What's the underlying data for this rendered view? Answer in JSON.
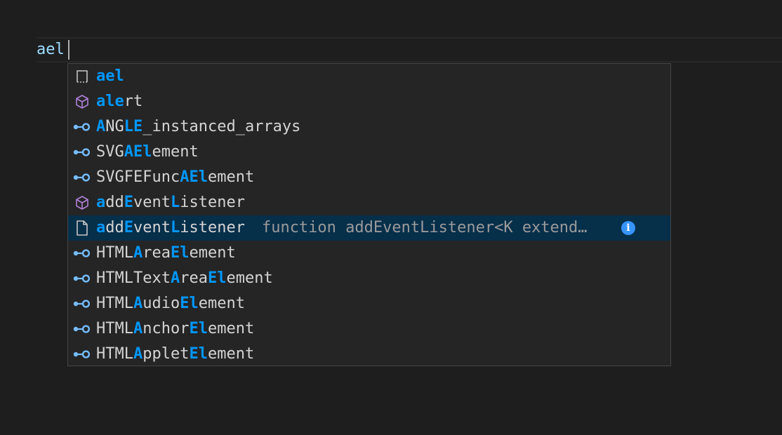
{
  "editor": {
    "typed_text": "ael"
  },
  "colors": {
    "background": "#1e1e1e",
    "widget_background": "#252526",
    "focused_background": "#062f4a",
    "highlight": "#0097fb",
    "text": "#d4d4d4",
    "detail_text": "#9a9a9a",
    "property_icon": "#75beff",
    "method_icon": "#b180d7"
  },
  "suggestions": [
    {
      "icon": "snippet-icon",
      "parts": [
        {
          "t": "ael",
          "h": true
        }
      ]
    },
    {
      "icon": "method-cube-icon",
      "parts": [
        {
          "t": "ale",
          "h": true
        },
        {
          "t": "rt",
          "h": false
        }
      ]
    },
    {
      "icon": "property-icon",
      "parts": [
        {
          "t": "A",
          "h": true
        },
        {
          "t": "NG",
          "h": false
        },
        {
          "t": "LE",
          "h": true
        },
        {
          "t": "_instanced_arrays",
          "h": false
        }
      ]
    },
    {
      "icon": "property-icon",
      "parts": [
        {
          "t": "SVG",
          "h": false
        },
        {
          "t": "AEl",
          "h": true
        },
        {
          "t": "ement",
          "h": false
        }
      ]
    },
    {
      "icon": "property-icon",
      "parts": [
        {
          "t": "SVGFEFunc",
          "h": false
        },
        {
          "t": "AEl",
          "h": true
        },
        {
          "t": "ement",
          "h": false
        }
      ]
    },
    {
      "icon": "method-cube-icon",
      "parts": [
        {
          "t": "a",
          "h": true
        },
        {
          "t": "dd",
          "h": false
        },
        {
          "t": "E",
          "h": true
        },
        {
          "t": "vent",
          "h": false
        },
        {
          "t": "L",
          "h": true
        },
        {
          "t": "istener",
          "h": false
        }
      ]
    },
    {
      "icon": "file-icon",
      "focused": true,
      "detail": "function addEventListener<K extend…",
      "info": "i",
      "parts": [
        {
          "t": "a",
          "h": true
        },
        {
          "t": "dd",
          "h": false
        },
        {
          "t": "E",
          "h": true
        },
        {
          "t": "vent",
          "h": false
        },
        {
          "t": "L",
          "h": true
        },
        {
          "t": "istener",
          "h": false
        }
      ]
    },
    {
      "icon": "property-icon",
      "parts": [
        {
          "t": "HTML",
          "h": false
        },
        {
          "t": "A",
          "h": true
        },
        {
          "t": "rea",
          "h": false
        },
        {
          "t": "El",
          "h": true
        },
        {
          "t": "ement",
          "h": false
        }
      ]
    },
    {
      "icon": "property-icon",
      "parts": [
        {
          "t": "HTMLText",
          "h": false
        },
        {
          "t": "A",
          "h": true
        },
        {
          "t": "rea",
          "h": false
        },
        {
          "t": "El",
          "h": true
        },
        {
          "t": "ement",
          "h": false
        }
      ]
    },
    {
      "icon": "property-icon",
      "parts": [
        {
          "t": "HTML",
          "h": false
        },
        {
          "t": "A",
          "h": true
        },
        {
          "t": "udio",
          "h": false
        },
        {
          "t": "El",
          "h": true
        },
        {
          "t": "ement",
          "h": false
        }
      ]
    },
    {
      "icon": "property-icon",
      "parts": [
        {
          "t": "HTML",
          "h": false
        },
        {
          "t": "A",
          "h": true
        },
        {
          "t": "nchor",
          "h": false
        },
        {
          "t": "El",
          "h": true
        },
        {
          "t": "ement",
          "h": false
        }
      ]
    },
    {
      "icon": "property-icon",
      "parts": [
        {
          "t": "HTML",
          "h": false
        },
        {
          "t": "A",
          "h": true
        },
        {
          "t": "pplet",
          "h": false
        },
        {
          "t": "El",
          "h": true
        },
        {
          "t": "ement",
          "h": false
        }
      ]
    }
  ]
}
